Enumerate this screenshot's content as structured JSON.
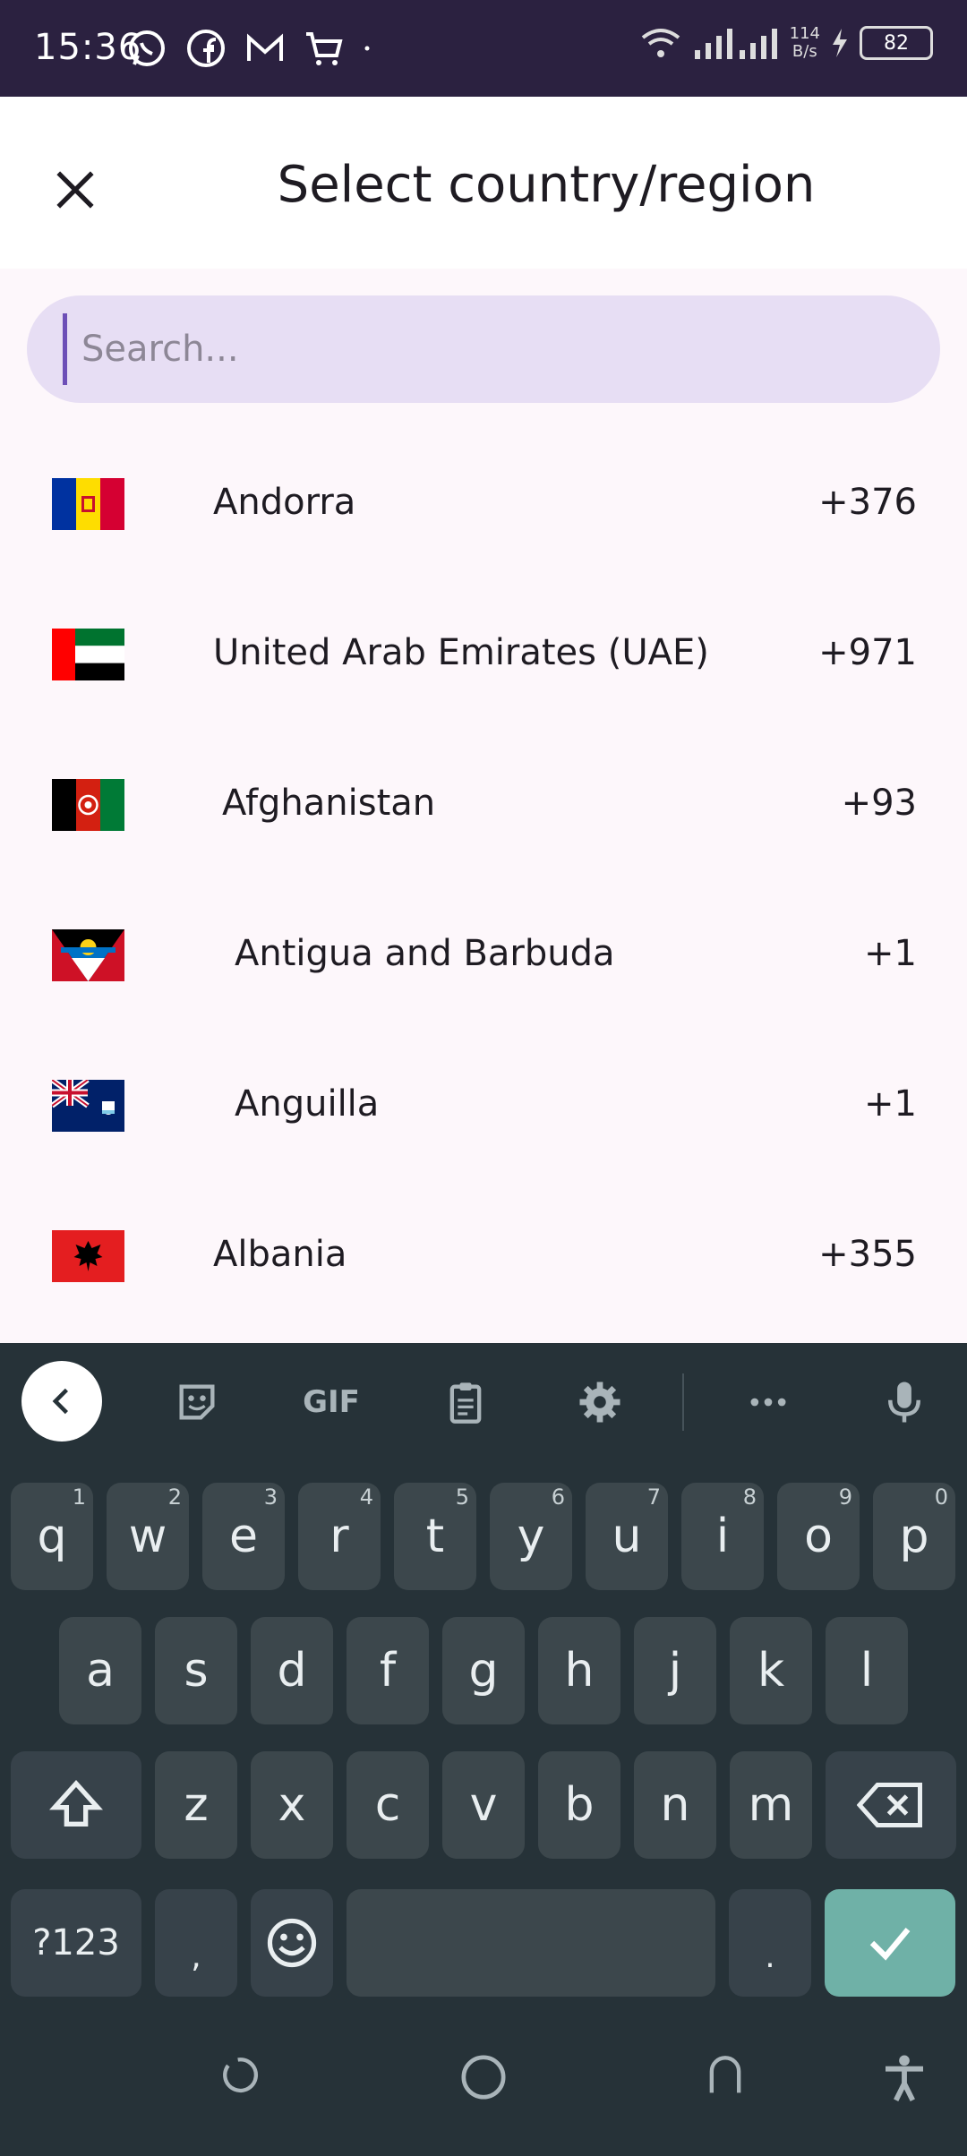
{
  "status_bar": {
    "time": "15:36",
    "speed_value": "114",
    "speed_unit": "B/s",
    "battery": "82"
  },
  "header": {
    "title": "Select country/region"
  },
  "search": {
    "placeholder": "Search..."
  },
  "countries": [
    {
      "name": "Andorra",
      "code": "+376",
      "flag": "andorra-flag-icon"
    },
    {
      "name": "United Arab Emirates (UAE)",
      "code": "+971",
      "flag": "uae-flag-icon"
    },
    {
      "name": "Afghanistan",
      "code": "+93",
      "flag": "afghanistan-flag-icon"
    },
    {
      "name": "Antigua and Barbuda",
      "code": "+1",
      "flag": "antigua-flag-icon"
    },
    {
      "name": "Anguilla",
      "code": "+1",
      "flag": "anguilla-flag-icon"
    },
    {
      "name": "Albania",
      "code": "+355",
      "flag": "albania-flag-icon"
    }
  ],
  "keyboard": {
    "toolbar": {
      "gif": "GIF"
    },
    "row1": [
      {
        "key": "q",
        "hint": "1"
      },
      {
        "key": "w",
        "hint": "2"
      },
      {
        "key": "e",
        "hint": "3"
      },
      {
        "key": "r",
        "hint": "4"
      },
      {
        "key": "t",
        "hint": "5"
      },
      {
        "key": "y",
        "hint": "6"
      },
      {
        "key": "u",
        "hint": "7"
      },
      {
        "key": "i",
        "hint": "8"
      },
      {
        "key": "o",
        "hint": "9"
      },
      {
        "key": "p",
        "hint": "0"
      }
    ],
    "row2": [
      "a",
      "s",
      "d",
      "f",
      "g",
      "h",
      "j",
      "k",
      "l"
    ],
    "row3": [
      "z",
      "x",
      "c",
      "v",
      "b",
      "n",
      "m"
    ],
    "symbols": "?123",
    "comma": ",",
    "period": "."
  },
  "colors": {
    "status_bar": "#2b2140",
    "search_bg": "#e7def4",
    "keyboard_bg": "#263238",
    "enter_key": "#6fb1a7"
  }
}
